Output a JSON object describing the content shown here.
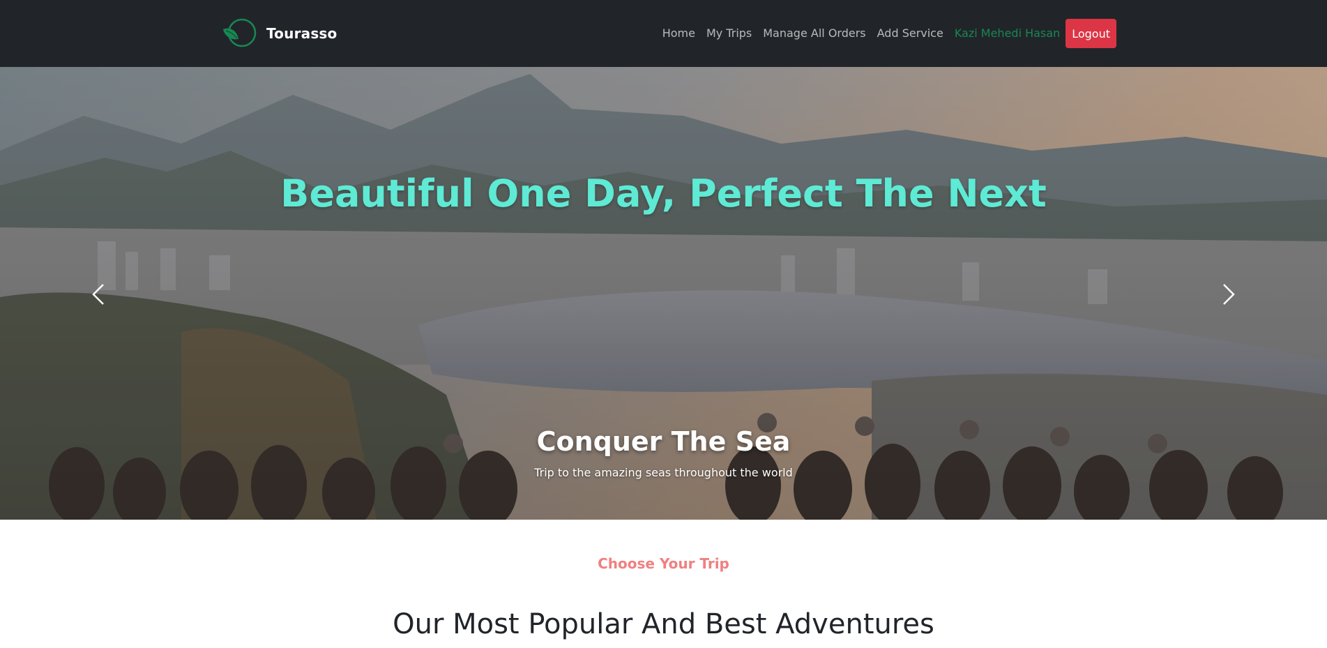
{
  "brand": {
    "name": "Tourasso",
    "logo_icon": "leaf-circle-logo",
    "logo_color": "#198754"
  },
  "nav": {
    "links": [
      "Home",
      "My Trips",
      "Manage All Orders",
      "Add Service"
    ],
    "user_name": "Kazi Mehedi Hasan",
    "logout_label": "Logout"
  },
  "hero": {
    "headline": "Beautiful One Day, Perfect The Next",
    "caption_title": "Conquer The Sea",
    "caption_text": "Trip to the amazing seas throughout the world",
    "prev_icon": "chevron-left-icon",
    "next_icon": "chevron-right-icon"
  },
  "section": {
    "kicker": "Choose Your Trip",
    "heading": "Our Most Popular And Best Adventures"
  },
  "colors": {
    "navbar_bg": "#212529",
    "accent_user": "#198754",
    "logout_bg": "#dc3545",
    "headline": "#5eead4",
    "kicker": "#f08080"
  }
}
